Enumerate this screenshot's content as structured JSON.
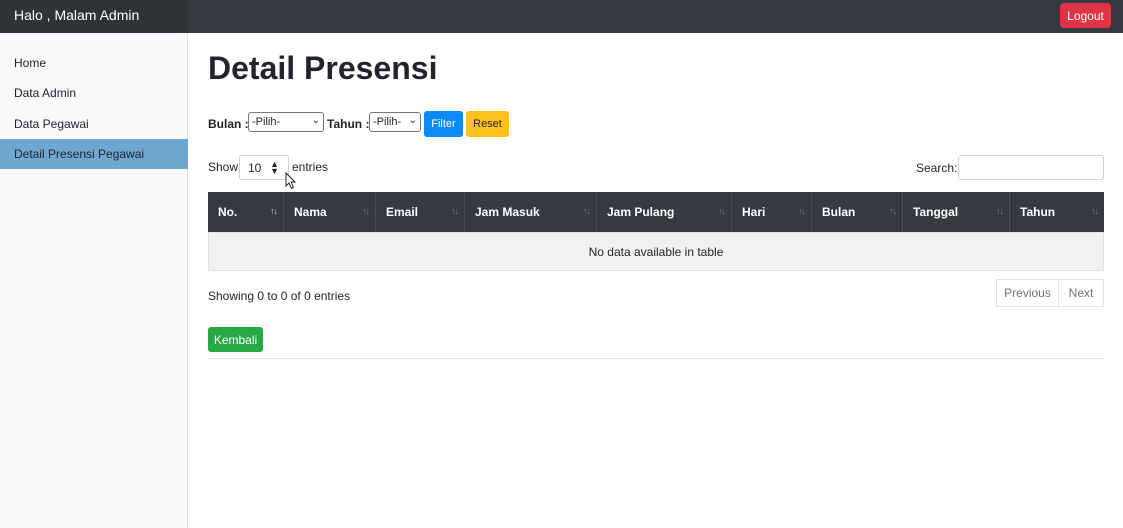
{
  "header": {
    "greeting": "Halo , Malam Admin",
    "logout_label": "Logout"
  },
  "sidebar": {
    "items": [
      {
        "label": "Home"
      },
      {
        "label": "Data Admin"
      },
      {
        "label": "Data Pegawai"
      },
      {
        "label": "Detail Presensi Pegawai",
        "active": true
      }
    ]
  },
  "page": {
    "title": "Detail Presensi"
  },
  "filter": {
    "bulan_label": "Bulan :",
    "bulan_value": "-Pilih-",
    "tahun_label": "Tahun :",
    "tahun_value": "-Pilih-",
    "filter_label": "Filter",
    "reset_label": "Reset"
  },
  "table_controls": {
    "show_label": "Show",
    "length_value": "10",
    "entries_label": "entries",
    "search_label": "Search:",
    "search_value": ""
  },
  "table": {
    "columns": [
      "No.",
      "Nama",
      "Email",
      "Jam Masuk",
      "Jam Pulang",
      "Hari",
      "Bulan",
      "Tanggal",
      "Tahun"
    ],
    "empty_message": "No data available in table"
  },
  "footer": {
    "info": "Showing 0 to 0 of 0 entries",
    "previous_label": "Previous",
    "next_label": "Next",
    "back_label": "Kembali"
  },
  "colors": {
    "navbar": "#343a40",
    "active_nav": "#6ea8d2",
    "logout": "#dc3545",
    "filter": "#0d8bf5",
    "reset": "#fcc21b",
    "back": "#28a745"
  }
}
